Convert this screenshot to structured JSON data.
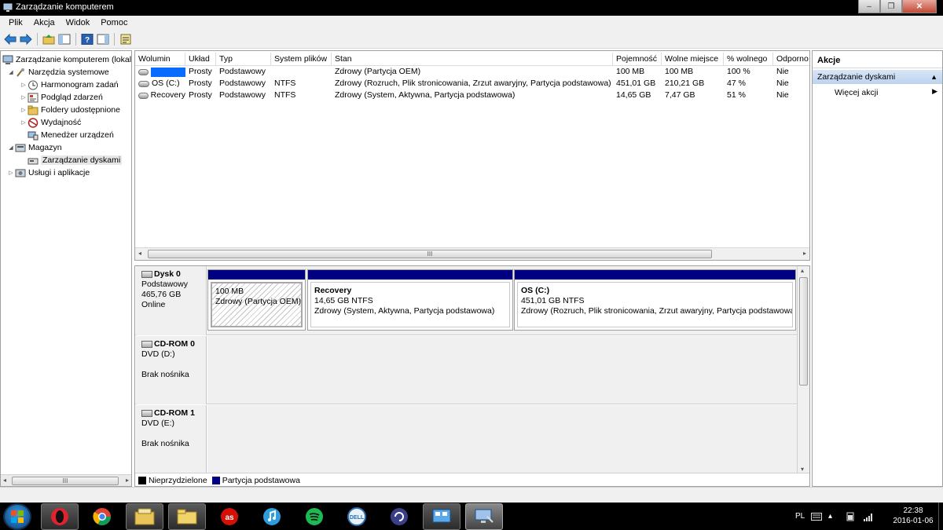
{
  "window": {
    "title": "Zarządzanie komputerem",
    "minimize": "–",
    "restore": "❐",
    "close": "✕"
  },
  "menu": [
    "Plik",
    "Akcja",
    "Widok",
    "Pomoc"
  ],
  "toolbar_icons": [
    "back-arrow-icon",
    "forward-arrow-icon",
    "up-folder-icon",
    "show-hide-tree-icon",
    "help-icon",
    "show-hide-action-pane-icon",
    "properties-icon"
  ],
  "tree": {
    "root": "Zarządzanie komputerem (lokalny)",
    "system_tools": "Narzędzia systemowe",
    "task_scheduler": "Harmonogram zadań",
    "event_viewer": "Podgląd zdarzeń",
    "shared_folders": "Foldery udostępnione",
    "performance": "Wydajność",
    "device_manager": "Menedżer urządzeń",
    "storage": "Magazyn",
    "disk_management": "Zarządzanie dyskami",
    "services_apps": "Usługi i aplikacje",
    "scroll_grip": "III"
  },
  "volume_table": {
    "columns": [
      "Wolumin",
      "Układ",
      "Typ",
      "System plików",
      "Stan",
      "Pojemność",
      "Wolne miejsce",
      "% wolnego",
      "Odporno"
    ],
    "rows": [
      [
        "",
        "Prosty",
        "Podstawowy",
        "",
        "Zdrowy (Partycja OEM)",
        "100 MB",
        "100 MB",
        "100 %",
        "Nie"
      ],
      [
        "OS (C:)",
        "Prosty",
        "Podstawowy",
        "NTFS",
        "Zdrowy (Rozruch, Plik stronicowania, Zrzut awaryjny, Partycja podstawowa)",
        "451,01 GB",
        "210,21 GB",
        "47 %",
        "Nie"
      ],
      [
        "Recovery",
        "Prosty",
        "Podstawowy",
        "NTFS",
        "Zdrowy (System, Aktywna, Partycja podstawowa)",
        "14,65 GB",
        "7,47 GB",
        "51 %",
        "Nie"
      ]
    ],
    "scroll_grip": "III"
  },
  "disks": {
    "disk0": {
      "name": "Dysk 0",
      "type": "Podstawowy",
      "size": "465,76 GB",
      "status": "Online",
      "partitions": [
        {
          "name": "",
          "size": "100 MB",
          "status": "Zdrowy (Partycja OEM)"
        },
        {
          "name": "Recovery",
          "size": "14,65 GB NTFS",
          "status": "Zdrowy (System, Aktywna, Partycja podstawowa)"
        },
        {
          "name": "OS  (C:)",
          "size": "451,01 GB NTFS",
          "status": "Zdrowy (Rozruch, Plik stronicowania, Zrzut awaryjny, Partycja podstawowa)"
        }
      ]
    },
    "cdrom0": {
      "name": "CD-ROM 0",
      "drive": "DVD (D:)",
      "media": "Brak nośnika"
    },
    "cdrom1": {
      "name": "CD-ROM 1",
      "drive": "DVD (E:)",
      "media": "Brak nośnika"
    }
  },
  "legend": {
    "unallocated": "Nieprzydzielone",
    "primary": "Partycja podstawowa",
    "unallocated_color": "#000000",
    "primary_color": "#000080"
  },
  "actions": {
    "title": "Akcje",
    "section": "Zarządzanie dyskami",
    "more": "Więcej akcji"
  },
  "taskbar": {
    "apps": [
      "opera",
      "chrome",
      "file-explorer",
      "folder",
      "lastfm",
      "itunes",
      "spotify",
      "dell",
      "cyberlink",
      "control-panel",
      "computer-management"
    ],
    "language": "PL",
    "time": "22:38",
    "date": "2016-01-06"
  }
}
